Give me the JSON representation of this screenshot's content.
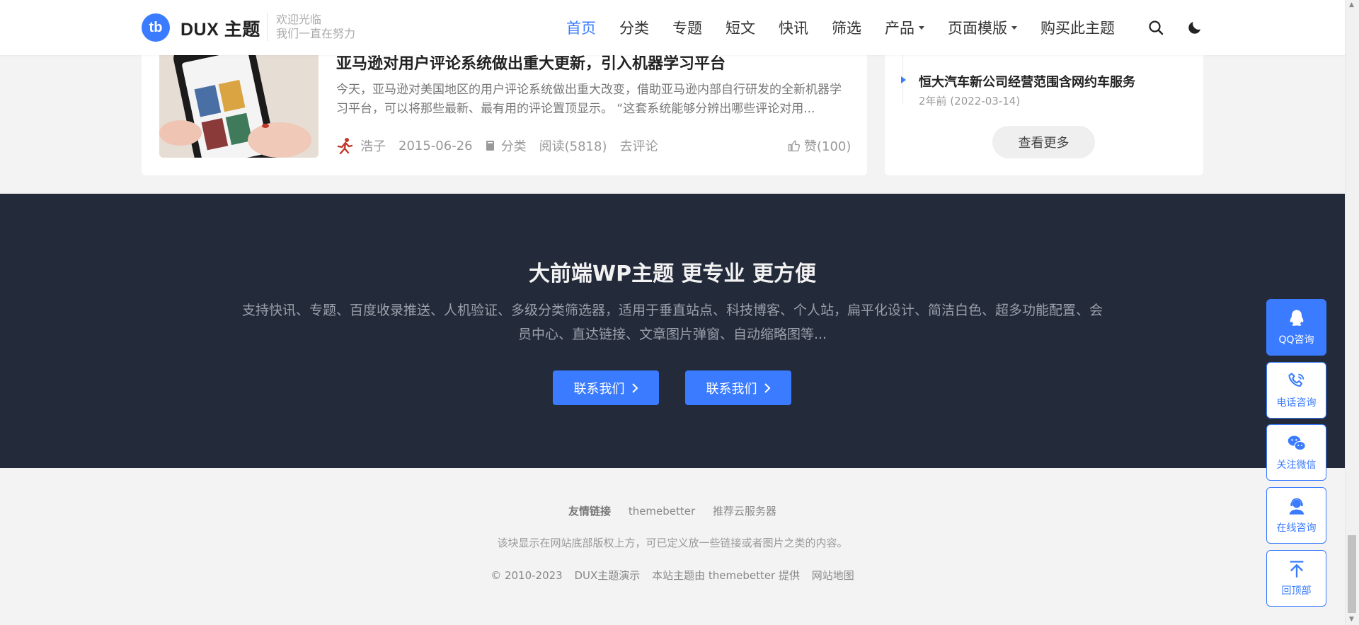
{
  "header": {
    "logo_text": "tb",
    "brand": "DUX 主题",
    "slogan_line1": "欢迎光临",
    "slogan_line2": "我们一直在努力",
    "nav": [
      {
        "label": "首页",
        "active": true
      },
      {
        "label": "分类"
      },
      {
        "label": "专题"
      },
      {
        "label": "短文"
      },
      {
        "label": "快讯"
      },
      {
        "label": "筛选"
      },
      {
        "label": "产品",
        "dropdown": true
      },
      {
        "label": "页面模版",
        "dropdown": true
      },
      {
        "label": "购买此主题"
      }
    ],
    "icons": [
      "search-icon",
      "moon-icon"
    ]
  },
  "post": {
    "title": "亚马逊对用户评论系统做出重大更新，引入机器学习平台",
    "excerpt": "今天，亚马逊对美国地区的用户评论系统做出重大改变，借助亚马逊内部自行研发的全新机器学习平台，可以将那些最新、最有用的评论置顶显示。 “这套系统能够分辨出哪些评论对用...",
    "author": "浩子",
    "date": "2015-06-26",
    "category": "分类",
    "reads": "阅读(5818)",
    "comment": "去评论",
    "likes": "赞(100)"
  },
  "sidebar": {
    "item_title": "恒大汽车新公司经营范围含网约车服务",
    "item_date": "2年前 (2022-03-14)",
    "more_label": "查看更多"
  },
  "banner": {
    "title": "大前端WP主题 更专业 更方便",
    "desc": "支持快讯、专题、百度收录推送、人机验证、多级分类筛选器，适用于垂直站点、科技博客、个人站，扁平化设计、简洁白色、超多功能配置、会员中心、直达链接、文章图片弹窗、自动缩略图等...",
    "button1": "联系我们",
    "button2": "联系我们"
  },
  "footer": {
    "links_label": "友情链接",
    "link1": "themebetter",
    "link2": "推荐云服务器",
    "note": "该块显示在网站底部版权上方，可已定义放一些链接或者图片之类的内容。",
    "copyright": "© 2010-2023",
    "site": "DUX主题演示",
    "powered": "本站主题由 themebetter 提供",
    "sitemap": "网站地图"
  },
  "float_buttons": [
    {
      "label": "QQ咨询",
      "icon": "qq-icon"
    },
    {
      "label": "电话咨询",
      "icon": "phone-icon"
    },
    {
      "label": "关注微信",
      "icon": "wechat-icon"
    },
    {
      "label": "在线咨询",
      "icon": "support-icon"
    },
    {
      "label": "回顶部",
      "icon": "back-to-top-icon"
    }
  ],
  "colors": {
    "accent": "#3a7bff",
    "banner_bg": "#232a39",
    "page_bg": "#f3f3f3"
  }
}
